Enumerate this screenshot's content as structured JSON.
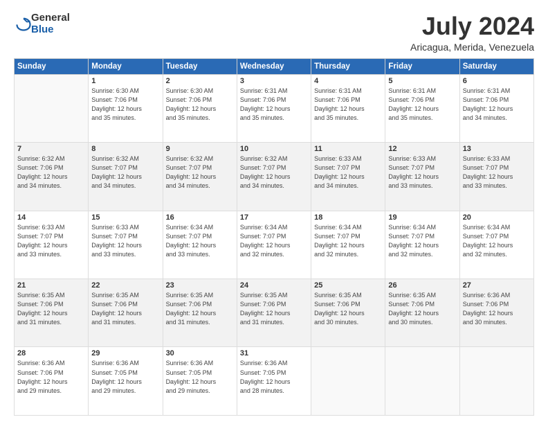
{
  "logo": {
    "general": "General",
    "blue": "Blue"
  },
  "title": "July 2024",
  "location": "Aricagua, Merida, Venezuela",
  "weekdays": [
    "Sunday",
    "Monday",
    "Tuesday",
    "Wednesday",
    "Thursday",
    "Friday",
    "Saturday"
  ],
  "weeks": [
    [
      {
        "day": "",
        "info": ""
      },
      {
        "day": "1",
        "info": "Sunrise: 6:30 AM\nSunset: 7:06 PM\nDaylight: 12 hours\nand 35 minutes."
      },
      {
        "day": "2",
        "info": "Sunrise: 6:30 AM\nSunset: 7:06 PM\nDaylight: 12 hours\nand 35 minutes."
      },
      {
        "day": "3",
        "info": "Sunrise: 6:31 AM\nSunset: 7:06 PM\nDaylight: 12 hours\nand 35 minutes."
      },
      {
        "day": "4",
        "info": "Sunrise: 6:31 AM\nSunset: 7:06 PM\nDaylight: 12 hours\nand 35 minutes."
      },
      {
        "day": "5",
        "info": "Sunrise: 6:31 AM\nSunset: 7:06 PM\nDaylight: 12 hours\nand 35 minutes."
      },
      {
        "day": "6",
        "info": "Sunrise: 6:31 AM\nSunset: 7:06 PM\nDaylight: 12 hours\nand 34 minutes."
      }
    ],
    [
      {
        "day": "7",
        "info": "Sunrise: 6:32 AM\nSunset: 7:06 PM\nDaylight: 12 hours\nand 34 minutes."
      },
      {
        "day": "8",
        "info": "Sunrise: 6:32 AM\nSunset: 7:07 PM\nDaylight: 12 hours\nand 34 minutes."
      },
      {
        "day": "9",
        "info": "Sunrise: 6:32 AM\nSunset: 7:07 PM\nDaylight: 12 hours\nand 34 minutes."
      },
      {
        "day": "10",
        "info": "Sunrise: 6:32 AM\nSunset: 7:07 PM\nDaylight: 12 hours\nand 34 minutes."
      },
      {
        "day": "11",
        "info": "Sunrise: 6:33 AM\nSunset: 7:07 PM\nDaylight: 12 hours\nand 34 minutes."
      },
      {
        "day": "12",
        "info": "Sunrise: 6:33 AM\nSunset: 7:07 PM\nDaylight: 12 hours\nand 33 minutes."
      },
      {
        "day": "13",
        "info": "Sunrise: 6:33 AM\nSunset: 7:07 PM\nDaylight: 12 hours\nand 33 minutes."
      }
    ],
    [
      {
        "day": "14",
        "info": "Sunrise: 6:33 AM\nSunset: 7:07 PM\nDaylight: 12 hours\nand 33 minutes."
      },
      {
        "day": "15",
        "info": "Sunrise: 6:33 AM\nSunset: 7:07 PM\nDaylight: 12 hours\nand 33 minutes."
      },
      {
        "day": "16",
        "info": "Sunrise: 6:34 AM\nSunset: 7:07 PM\nDaylight: 12 hours\nand 33 minutes."
      },
      {
        "day": "17",
        "info": "Sunrise: 6:34 AM\nSunset: 7:07 PM\nDaylight: 12 hours\nand 32 minutes."
      },
      {
        "day": "18",
        "info": "Sunrise: 6:34 AM\nSunset: 7:07 PM\nDaylight: 12 hours\nand 32 minutes."
      },
      {
        "day": "19",
        "info": "Sunrise: 6:34 AM\nSunset: 7:07 PM\nDaylight: 12 hours\nand 32 minutes."
      },
      {
        "day": "20",
        "info": "Sunrise: 6:34 AM\nSunset: 7:07 PM\nDaylight: 12 hours\nand 32 minutes."
      }
    ],
    [
      {
        "day": "21",
        "info": "Sunrise: 6:35 AM\nSunset: 7:06 PM\nDaylight: 12 hours\nand 31 minutes."
      },
      {
        "day": "22",
        "info": "Sunrise: 6:35 AM\nSunset: 7:06 PM\nDaylight: 12 hours\nand 31 minutes."
      },
      {
        "day": "23",
        "info": "Sunrise: 6:35 AM\nSunset: 7:06 PM\nDaylight: 12 hours\nand 31 minutes."
      },
      {
        "day": "24",
        "info": "Sunrise: 6:35 AM\nSunset: 7:06 PM\nDaylight: 12 hours\nand 31 minutes."
      },
      {
        "day": "25",
        "info": "Sunrise: 6:35 AM\nSunset: 7:06 PM\nDaylight: 12 hours\nand 30 minutes."
      },
      {
        "day": "26",
        "info": "Sunrise: 6:35 AM\nSunset: 7:06 PM\nDaylight: 12 hours\nand 30 minutes."
      },
      {
        "day": "27",
        "info": "Sunrise: 6:36 AM\nSunset: 7:06 PM\nDaylight: 12 hours\nand 30 minutes."
      }
    ],
    [
      {
        "day": "28",
        "info": "Sunrise: 6:36 AM\nSunset: 7:06 PM\nDaylight: 12 hours\nand 29 minutes."
      },
      {
        "day": "29",
        "info": "Sunrise: 6:36 AM\nSunset: 7:05 PM\nDaylight: 12 hours\nand 29 minutes."
      },
      {
        "day": "30",
        "info": "Sunrise: 6:36 AM\nSunset: 7:05 PM\nDaylight: 12 hours\nand 29 minutes."
      },
      {
        "day": "31",
        "info": "Sunrise: 6:36 AM\nSunset: 7:05 PM\nDaylight: 12 hours\nand 28 minutes."
      },
      {
        "day": "",
        "info": ""
      },
      {
        "day": "",
        "info": ""
      },
      {
        "day": "",
        "info": ""
      }
    ]
  ]
}
